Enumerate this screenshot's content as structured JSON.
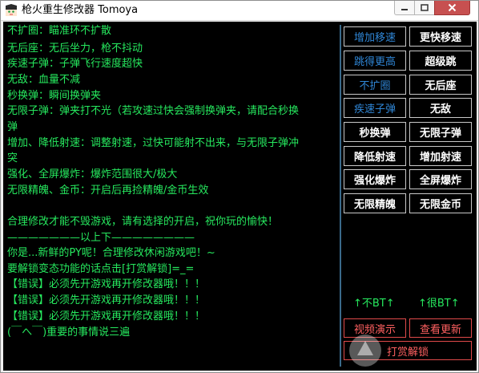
{
  "window": {
    "title": "枪火重生修改器  Tomoya"
  },
  "log": [
    "不扩圈：瞄准环不扩散",
    "无后座：无后坐力，枪不抖动",
    "疾速子弹：子弹飞行速度超快",
    "无敌：血量不减",
    "秒换弹：瞬间换弹夹",
    "无限子弹：弹夹打不光（若攻速过快会强制换弹夹，请配合秒换",
    "弹",
    "增加、降低射速：调整射速，过快可能射不出来，与无限子弹冲",
    "突",
    "强化、全屏爆炸：爆炸范围很大/极大",
    "无限精魄、金币：开启后再捡精魄/金币生效",
    "",
    "合理修改才能不毁游戏，请有选择的开启，祝你玩的愉快！",
    "———————以上下————————",
    "你是...新鲜的PY呢！合理修改休闲游戏吧！~",
    "要解锁变态功能的话点击[打赏解锁]=_=",
    "【错误】必须先开游戏再开修改器哦！！！",
    "【错误】必须先开游戏再开修改器哦！！！",
    "【错误】必须先开游戏再开修改器哦！！！",
    "(￣へ￣)重要的事情说三遍"
  ],
  "buttons": [
    {
      "label": "增加移速",
      "style": "blue"
    },
    {
      "label": "更快移速",
      "style": "white"
    },
    {
      "label": "跳得更高",
      "style": "blue"
    },
    {
      "label": "超级跳",
      "style": "white"
    },
    {
      "label": "不扩圈",
      "style": "blue"
    },
    {
      "label": "无后座",
      "style": "white"
    },
    {
      "label": "疾速子弹",
      "style": "blue"
    },
    {
      "label": "无敌",
      "style": "white"
    },
    {
      "label": "秒换弹",
      "style": "white"
    },
    {
      "label": "无限子弹",
      "style": "white"
    },
    {
      "label": "降低射速",
      "style": "white"
    },
    {
      "label": "增加射速",
      "style": "white"
    },
    {
      "label": "强化爆炸",
      "style": "white"
    },
    {
      "label": "全屏爆炸",
      "style": "white"
    },
    {
      "label": "无限精魄",
      "style": "white"
    },
    {
      "label": "无限金币",
      "style": "white"
    }
  ],
  "notes": {
    "not_bt": "↑不BT↑",
    "very_bt": "↑很BT↑"
  },
  "bottom_buttons": {
    "video": "视频演示",
    "update": "查看更新",
    "tip": "打赏解锁"
  },
  "colors": {
    "log_text": "#26e85e",
    "blue_button_text": "#2f86d6",
    "white_button_text": "#ffffff",
    "red_button": "#ff6060"
  }
}
